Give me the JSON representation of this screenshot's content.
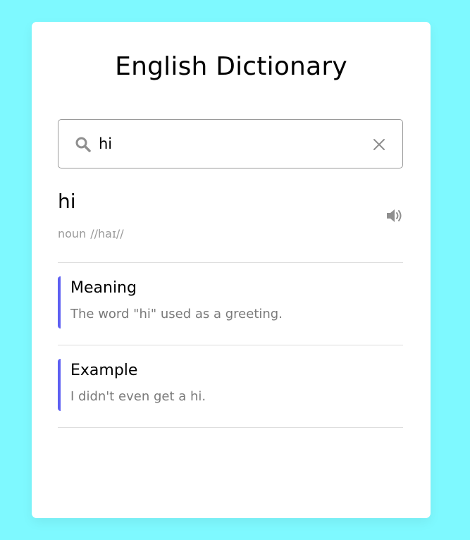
{
  "app": {
    "title": "English Dictionary"
  },
  "search": {
    "value": "hi",
    "icon": "search-icon",
    "clear_icon": "close-icon"
  },
  "result": {
    "word": "hi",
    "part_of_speech": "noun",
    "phonetic": "//haɪ//",
    "audio_icon": "speaker-icon"
  },
  "sections": [
    {
      "title": "Meaning",
      "text": "The word \"hi\" used as a greeting."
    },
    {
      "title": "Example",
      "text": "I didn't even get a hi."
    }
  ],
  "colors": {
    "background": "#7ef9ff",
    "card": "#ffffff",
    "accent": "#5d5ff2",
    "muted": "#9a9a9a"
  }
}
